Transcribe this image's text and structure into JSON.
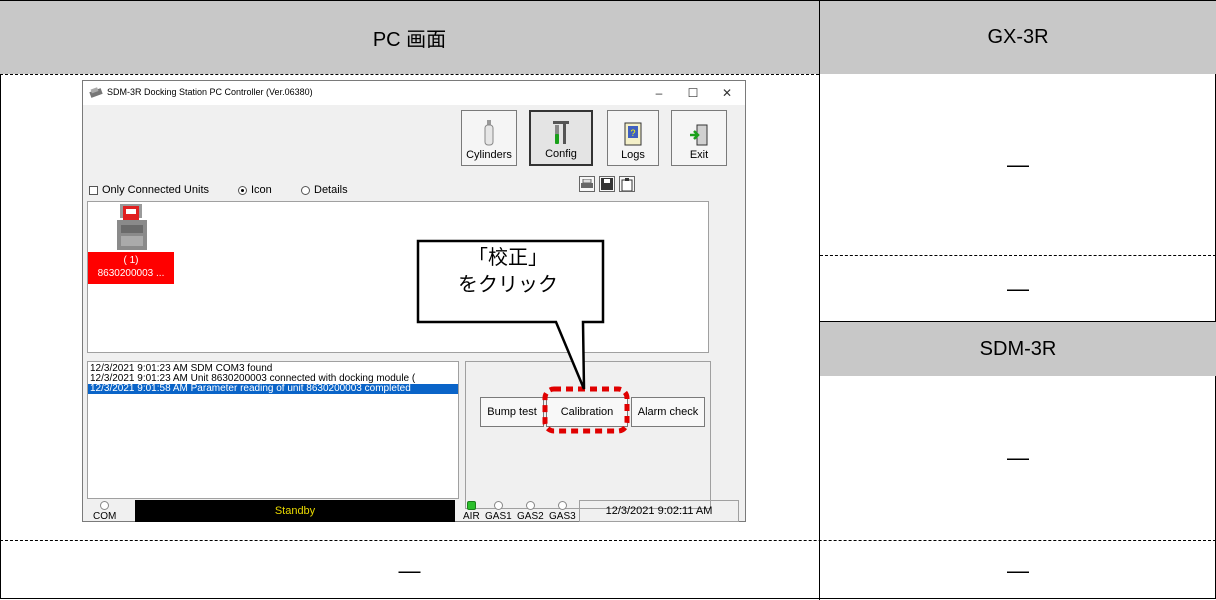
{
  "table": {
    "col1_header": "PC 画面",
    "col2_header": "GX-3R",
    "sdm_header": "SDM-3R",
    "dash": "—"
  },
  "window": {
    "title": "SDM-3R Docking Station PC Controller (Ver.06380)",
    "controls": {
      "minimize": "–",
      "maximize": "☐",
      "close": "✕"
    },
    "toolbar": [
      {
        "label": "Cylinders",
        "icon": "gas-cylinder-icon"
      },
      {
        "label": "Config",
        "icon": "tools-icon",
        "pressed": true
      },
      {
        "label": "Logs",
        "icon": "logs-book-icon"
      },
      {
        "label": "Exit",
        "icon": "exit-door-icon"
      }
    ],
    "options": {
      "only_connected": "Only Connected Units",
      "icon_view": "Icon",
      "details_view": "Details",
      "selected_view": "Icon"
    },
    "unit": {
      "slot": "( 1)",
      "serial": "8630200003 ..."
    },
    "log": [
      {
        "text": "12/3/2021 9:01:23 AM SDM COM3 found",
        "selected": false
      },
      {
        "text": "12/3/2021 9:01:23 AM Unit 8630200003 connected with docking module (",
        "selected": false
      },
      {
        "text": "12/3/2021 9:01:58 AM Parameter reading of unit 8630200003 completed",
        "selected": true
      }
    ],
    "actions": {
      "bump_test": "Bump test",
      "calibration": "Calibration",
      "alarm_check": "Alarm check"
    },
    "status": {
      "com": "COM",
      "state": "Standby",
      "indicators": [
        "AIR",
        "GAS1",
        "GAS2",
        "GAS3"
      ],
      "active_indicator": "AIR",
      "datetime": "12/3/2021 9:02:11 AM"
    }
  },
  "callout": {
    "line1": "「校正」",
    "line2": "をクリック"
  },
  "colors": {
    "header_bg": "#c8c8c8",
    "unit_alert": "#ff0000",
    "highlight_dash": "#e00000",
    "status_text": "#e8d800",
    "selected_row": "#0a64c8"
  }
}
